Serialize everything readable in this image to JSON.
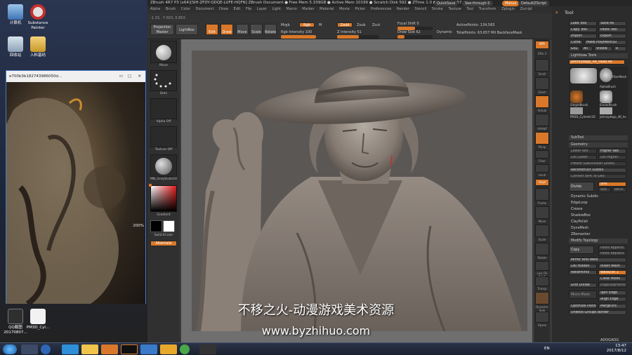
{
  "desktop": {
    "icons": [
      {
        "label": "计算机"
      },
      {
        "label": "Substance Painter"
      },
      {
        "label": "回收站"
      },
      {
        "label": "入料基码"
      },
      {
        "label": "QQ截图20170807..."
      },
      {
        "label": "PM3D_Cyl..."
      }
    ],
    "viewer": {
      "title": "e700b3b182743986050d...",
      "zoom": "200%"
    }
  },
  "zbrush": {
    "title": "ZBrush 4R7 P3 (x64)[SIH-ZFDY-QDQE-LUFE-HQFN]   ZBrush Document   ● Free Mem 5.339GB ● Active Mem 10199 ● Scratch Disk 592 ● ZTime 1.0 ● ATime 0.057 ● Po",
    "quicksave": "QuickSave",
    "see_through": "See-through 0",
    "menus_label": "Menus",
    "script_label": "DefaultZScript",
    "menu": [
      "Alpha",
      "Brush",
      "Color",
      "Document",
      "Draw",
      "Edit",
      "File",
      "Layer",
      "Light",
      "Macro",
      "Marker",
      "Material",
      "Movie",
      "Picker",
      "Preferences",
      "Render",
      "Stencil",
      "Stroke",
      "Texture",
      "Tool",
      "Transform",
      "Zplugin",
      "Zscript"
    ],
    "toolbar": {
      "projection_master": "Projection Master",
      "lightbox": "LightBox",
      "edit": "Edit",
      "draw": "Draw",
      "move": "Move",
      "scale": "Scale",
      "rotate": "Rotate",
      "mrgb": "Mrgb",
      "rgb": "Rgb",
      "m": "M",
      "zadd": "Zadd",
      "zsub": "Zsub",
      "zcut": "Zcut",
      "rgb_intensity": "Rgb Intensity 100",
      "z_intensity": "Z Intensity 51",
      "focal_shift": "Focal Shift 0",
      "draw_size": "Draw Size 62",
      "dynamic": "Dynamic",
      "active_points": "ActivePoints: 134,583",
      "total_points": "TotalPoints: 63.657 Mil  BackfaceMask",
      "coords": "-1.33, -7.603, 0.853"
    },
    "shelf": [
      {
        "label": "Move"
      },
      {
        "label": "Dots"
      },
      {
        "label": "Alpha Off"
      },
      {
        "label": "Texture Off"
      },
      {
        "label": "MB_GreyScale10"
      },
      {
        "label": "Gradient"
      },
      {
        "label": "SwitchColor"
      },
      {
        "label": "Alternate"
      }
    ],
    "right_shelf": [
      {
        "label": "BPR"
      },
      {
        "label": "SPix 3"
      },
      {
        "label": "Scroll"
      },
      {
        "label": "Zoom"
      },
      {
        "label": "Actual"
      },
      {
        "label": "AAHalf"
      },
      {
        "label": "Persp"
      },
      {
        "label": "Floor"
      },
      {
        "label": "Local"
      },
      {
        "label": "Gxyz"
      },
      {
        "label": "Frame"
      },
      {
        "label": "Move"
      },
      {
        "label": "Scale"
      },
      {
        "label": "Rotate"
      },
      {
        "label": "Line Fill PolyF"
      },
      {
        "label": "Transp"
      },
      {
        "label": "Dynamic Solo"
      },
      {
        "label": "Xpose"
      }
    ],
    "tool_panel": {
      "title": "Tool",
      "buttons": [
        "Load Tool",
        "Save As",
        "Copy Tool",
        "Paste Tool",
        "Import",
        "Export",
        "Clone",
        "Make PolyMesh3D",
        "GoZ",
        "All",
        "Visible",
        "R"
      ],
      "lightbox_tools": "Lightbox▸ Tools",
      "current_tool": "johnnydepp_48_head 48",
      "tool_names": [
        "SimpleBrush",
        "EraserBrush",
        "PM3D_Cylinder3D",
        "johnnydepp_48_he",
        "AlphaBrush",
        "FiberMesh"
      ],
      "subtool": "SubTool",
      "geometry": "Geometry",
      "higher_res": "Higher Res",
      "lower_res": "Lower Res",
      "del_lower": "Del Lower",
      "del_higher": "Del Higher",
      "freeze_subdiv": "Freeze SubDivision Levels",
      "reconstruct": "Reconstruct Subdiv",
      "convert_bpr": "Convert BPR To Geo",
      "divide": "Divide",
      "smt": "Smt",
      "suv": "Suv",
      "rel": "ReUV",
      "dynamic_subdiv": "Dynamic Subdiv",
      "edgeloop": "EdgeLoop",
      "crease": "Crease",
      "shadowbox": "ShadowBox",
      "claypolish": "ClayPolish",
      "dynamesh": "DynaMesh",
      "zremesher": "ZRemesher",
      "modify_topology": "Modify Topology",
      "copy": "Copy",
      "paste_append": "Paste Append",
      "paste_replace": "Paste Replace",
      "mirror_and_weld": "Mirror And Weld",
      "del_hidden": "Del Hidden",
      "insert_mesh": "Insert Mesh",
      "weld_points": "WeldPoints",
      "weld_dist": "WeldDist 1",
      "close_holes": "Close Holes",
      "grid_divide": "Grid Divide",
      "edit_segments": "EdgeSegments",
      "micro_mesh": "Micro Mesh",
      "spin_edge": "Spin Edge",
      "align_edge": "Align Edge",
      "optimize_points": "Optimize Points",
      "merge_tris": "MergeTris",
      "unweld_groups": "Unweld Groups Border"
    }
  },
  "watermark": {
    "line1": "不移之火-动漫游戏美术资源",
    "line2": "www.byzhihuo.com"
  },
  "taskbar": {
    "lang": "EN",
    "time": "13:47",
    "date": "2017/8/12",
    "corner": "ADOGAOG"
  },
  "colors": {
    "accent": "#d9782a",
    "panel": "#2c2c2c",
    "canvas": "#6f6f6f"
  }
}
